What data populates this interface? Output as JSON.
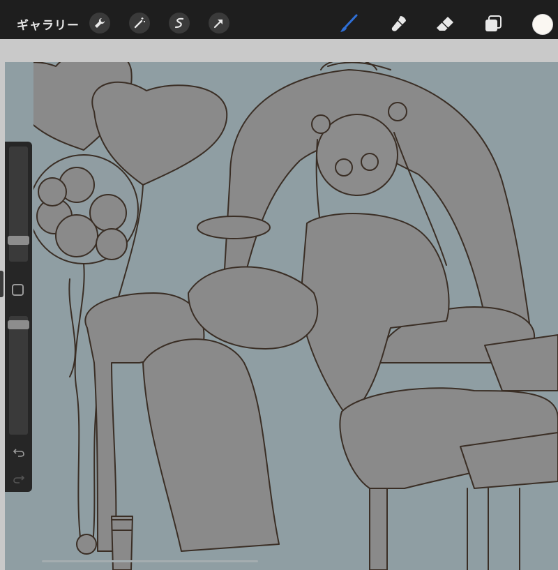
{
  "toolbar": {
    "gallery_label": "ギャラリー",
    "actions_icon": "wrench-icon",
    "adjustments_icon": "magic-wand-icon",
    "selection_icon": "selection-s-icon",
    "transform_icon": "arrow-icon",
    "brush_icon": "brush-icon",
    "smudge_icon": "smudge-icon",
    "eraser_icon": "eraser-icon",
    "layers_icon": "layers-icon",
    "current_color": "#faf7f2"
  },
  "sidebar": {
    "brush_size_level": 0.82,
    "opacity_level": 0.04,
    "modify_icon": "square-modify-icon",
    "undo_icon": "undo-icon",
    "redo_icon": "redo-icon"
  },
  "colors": {
    "canvas_bg": "#8f9ea3",
    "line_color": "#3a2e25",
    "fill_gray": "#8a8a8a",
    "brush_accent": "#2f6fd6"
  }
}
